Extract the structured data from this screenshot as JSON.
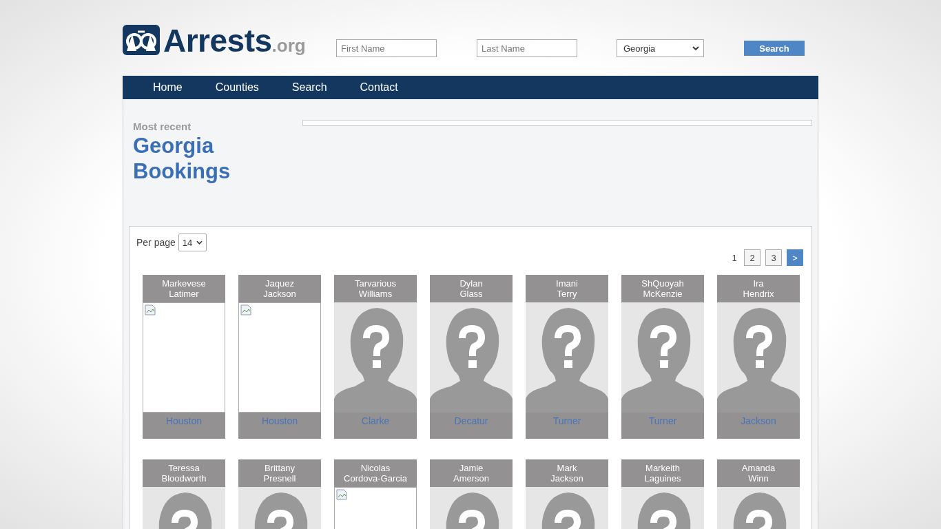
{
  "logo": {
    "name": "Arrests",
    "suffix": ".org"
  },
  "search": {
    "first_name": {
      "placeholder": "First Name"
    },
    "last_name": {
      "placeholder": "Last Name"
    },
    "state": {
      "value": "Georgia"
    },
    "button": "Search"
  },
  "nav": [
    "Home",
    "Counties",
    "Search",
    "Contact"
  ],
  "heading": {
    "kicker": "Most recent",
    "title_lines": [
      "Georgia",
      "Bookings"
    ]
  },
  "per_page": {
    "label": "Per page",
    "value": "14"
  },
  "pagination": [
    {
      "label": "1",
      "selected": true
    },
    {
      "label": "2",
      "selected": false
    },
    {
      "label": "3",
      "selected": false
    },
    {
      "label": ">",
      "selected": false,
      "kind": "next"
    }
  ],
  "rows": [
    [
      {
        "first": "Markevese",
        "last": "Latimer",
        "kind": "broken",
        "county": "Houston"
      },
      {
        "first": "Jaquez",
        "last": "Jackson",
        "kind": "broken",
        "county": "Houston"
      },
      {
        "first": "Tarvarious",
        "last": "Williams",
        "kind": "placeholder",
        "county": "Clarke"
      },
      {
        "first": "Dylan",
        "last": "Glass",
        "kind": "placeholder",
        "county": "Decatur"
      },
      {
        "first": "Imani",
        "last": "Terry",
        "kind": "placeholder",
        "county": "Turner"
      },
      {
        "first": "ShQuoyah",
        "last": "McKenzie",
        "kind": "placeholder",
        "county": "Turner"
      },
      {
        "first": "Ira",
        "last": "Hendrix",
        "kind": "placeholder",
        "county": "Jackson"
      }
    ],
    [
      {
        "first": "Teressa",
        "last": "Bloodworth",
        "kind": "placeholder"
      },
      {
        "first": "Brittany",
        "last": "Presnell",
        "kind": "placeholder"
      },
      {
        "first": "Nicolas",
        "last": "Cordova-Garcia",
        "kind": "broken"
      },
      {
        "first": "Jamie",
        "last": "Amerson",
        "kind": "placeholder"
      },
      {
        "first": "Mark",
        "last": "Jackson",
        "kind": "placeholder"
      },
      {
        "first": "Markeith",
        "last": "Laguines",
        "kind": "placeholder"
      },
      {
        "first": "Amanda",
        "last": "Winn",
        "kind": "placeholder"
      }
    ]
  ]
}
